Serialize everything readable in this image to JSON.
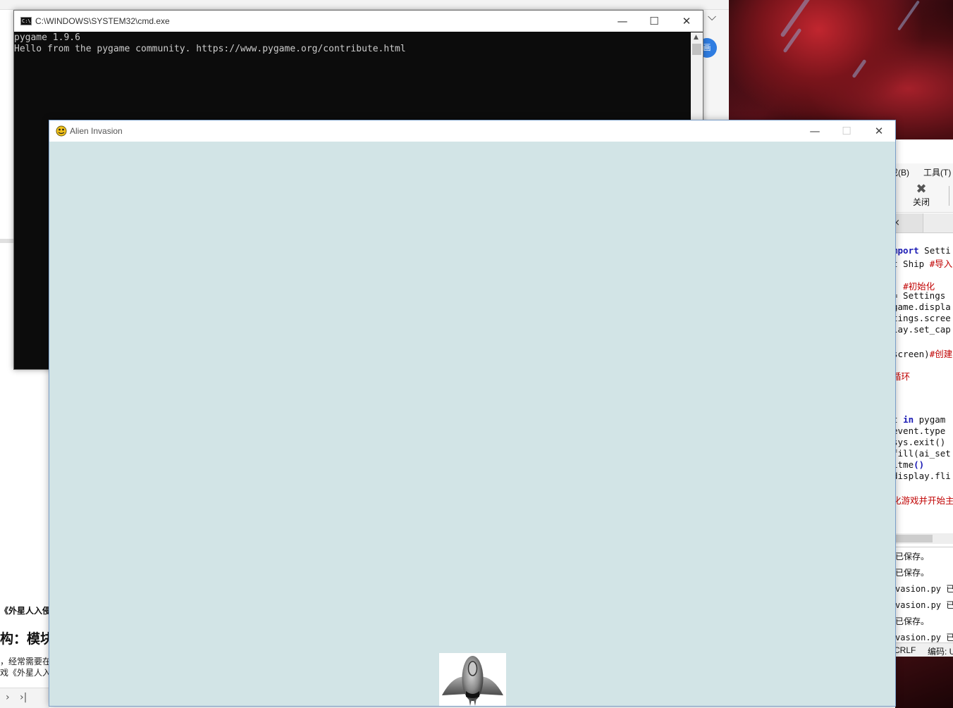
{
  "background_doc": {
    "collapse_icon": "chevron-down-icon",
    "blue_button_glyph": "画",
    "heading_fragment": "《外星人入侵",
    "subheading_fragment": "构：模块",
    "paragraph_line1": "，经常需要在",
    "paragraph_line2": "戏《外星人入",
    "nav_prev": "›",
    "nav_last": "›|"
  },
  "ide": {
    "menu": [
      "成(B)",
      "工具(T)"
    ],
    "close_button_label": "关闭",
    "tab_close_glyph": "×",
    "code_lines": [
      {
        "parts": [
          {
            "t": "kw",
            "v": "mport"
          },
          {
            "t": "tx",
            "v": " Setti"
          }
        ]
      },
      {
        "parts": [
          {
            "t": "tx",
            "v": "t Ship "
          },
          {
            "t": "cm",
            "v": "#导入"
          }
        ]
      },
      {
        "parts": []
      },
      {
        "parts": [
          {
            "t": "tx",
            "v": ") "
          },
          {
            "t": "cm",
            "v": "#初始化"
          }
        ]
      },
      {
        "parts": [
          {
            "t": "tx",
            "v": "= Settings"
          }
        ]
      },
      {
        "parts": [
          {
            "t": "tx",
            "v": "game.displa"
          }
        ]
      },
      {
        "parts": [
          {
            "t": "tx",
            "v": "tings.scree"
          }
        ]
      },
      {
        "parts": [
          {
            "t": "tx",
            "v": "lay.set_cap"
          }
        ]
      },
      {
        "parts": []
      },
      {
        "parts": [
          {
            "t": "tx",
            "v": "screen)"
          },
          {
            "t": "cm",
            "v": "#创建"
          }
        ]
      },
      {
        "parts": []
      },
      {
        "parts": [
          {
            "t": "cm",
            "v": "循环"
          }
        ]
      },
      {
        "parts": []
      },
      {
        "parts": []
      },
      {
        "parts": []
      },
      {
        "parts": [
          {
            "t": "tx",
            "v": "t "
          },
          {
            "t": "kw",
            "v": "in"
          },
          {
            "t": "tx",
            "v": " pygam"
          }
        ]
      },
      {
        "parts": [
          {
            "t": "tx",
            "v": "event.type"
          }
        ]
      },
      {
        "parts": [
          {
            "t": "tx",
            "v": "sys.exit()"
          }
        ]
      },
      {
        "parts": [
          {
            "t": "tx",
            "v": "fill(ai_set"
          }
        ]
      },
      {
        "parts": [
          {
            "t": "tx",
            "v": "itme"
          },
          {
            "t": "kw",
            "v": "()"
          }
        ]
      },
      {
        "parts": [
          {
            "t": "tx",
            "v": "display.fli"
          }
        ]
      },
      {
        "parts": []
      },
      {
        "parts": [
          {
            "t": "cm",
            "v": "化游戏并开始主"
          }
        ]
      }
    ],
    "output_lines": [
      "已保存。",
      "已保存。",
      "vasion.py 已",
      "vasion.py 已",
      "已保存。",
      "vasion.py 已"
    ],
    "status_eol": "CRLF",
    "status_encoding": "编码: U"
  },
  "cmd": {
    "title": "C:\\WINDOWS\\SYSTEM32\\cmd.exe",
    "icon_text": "C:\\",
    "minimize": "—",
    "maximize": "☐",
    "close": "✕",
    "lines": [
      "pygame 1.9.6",
      "Hello from the pygame community. https://www.pygame.org/contribute.html"
    ]
  },
  "game": {
    "title": "Alien Invasion",
    "minimize": "—",
    "maximize": "☐",
    "close": "✕",
    "background_color": "#d2e4e6"
  },
  "colors": {
    "console_bg": "#0c0c0c",
    "console_fg": "#cccccc",
    "code_keyword": "#1b1bb5",
    "code_comment": "#c00000"
  }
}
